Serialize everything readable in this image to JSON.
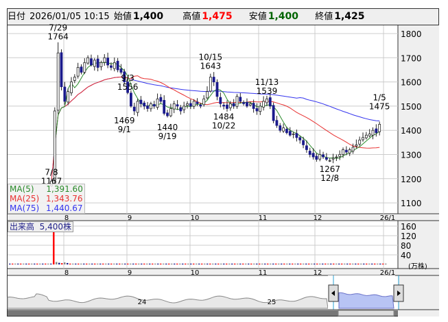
{
  "header": {
    "date_label": "日付",
    "datetime": "2026/01/05 10:15",
    "open_label": "始値",
    "open": "1,400",
    "high_label": "高値",
    "high": "1,475",
    "low_label": "安値",
    "low": "1,400",
    "close_label": "終値",
    "close": "1,425"
  },
  "colors": {
    "ma5": "#2a8a2a",
    "ma25": "#e83030",
    "ma75": "#3333ee",
    "high": "#ff0000",
    "low": "#006400",
    "candle_down": "#1a1a8c",
    "vol_up": "#ff0000",
    "vol_down": "#1a1a8c"
  },
  "legend": {
    "ma5_label": "MA(5)",
    "ma5": "1,391.60",
    "ma25_label": "MA(25)",
    "ma25": "1,343.76",
    "ma75_label": "MA(75)",
    "ma75": "1,440.67"
  },
  "volume": {
    "label": "出来高",
    "value": "5,400株",
    "unit": "(万株)"
  },
  "chart_data": {
    "type": "candlestick",
    "y_ticks": [
      1100,
      1200,
      1300,
      1400,
      1500,
      1600,
      1700,
      1800
    ],
    "ylim": [
      1060,
      1840
    ],
    "x_ticks": [
      "8",
      "9",
      "10",
      "11",
      "12",
      "26/1"
    ],
    "closes": [
      1190,
      1480,
      1720,
      1580,
      1520,
      1560,
      1600,
      1620,
      1660,
      1640,
      1680,
      1700,
      1670,
      1690,
      1660,
      1680,
      1700,
      1670,
      1660,
      1680,
      1650,
      1640,
      1600,
      1556,
      1500,
      1480,
      1520,
      1510,
      1500,
      1490,
      1510,
      1500,
      1530,
      1520,
      1470,
      1460,
      1490,
      1510,
      1500,
      1480,
      1500,
      1510,
      1500,
      1520,
      1510,
      1500,
      1530,
      1560,
      1620,
      1600,
      1540,
      1510,
      1500,
      1490,
      1510,
      1500,
      1540,
      1520,
      1510,
      1500,
      1510,
      1490,
      1480,
      1500,
      1520,
      1530,
      1500,
      1440,
      1420,
      1400,
      1410,
      1390,
      1380,
      1385,
      1370,
      1360,
      1340,
      1320,
      1300,
      1290,
      1280,
      1300,
      1290,
      1280,
      1275,
      1285,
      1290,
      1300,
      1320,
      1310,
      1320,
      1330,
      1340,
      1360,
      1370,
      1380,
      1385,
      1400,
      1390,
      1425
    ],
    "annotations": [
      {
        "date": "7/8",
        "value": "1167",
        "i": 0,
        "pos": "above"
      },
      {
        "date": "7/29",
        "value": "1764",
        "i": 2,
        "pos": "above"
      },
      {
        "date": "9/3",
        "value": "1556",
        "i": 23,
        "pos": "above"
      },
      {
        "date": "9/1",
        "value": "1469",
        "i": 22,
        "pos": "below"
      },
      {
        "date": "9/19",
        "value": "1440",
        "i": 35,
        "pos": "below"
      },
      {
        "date": "10/15",
        "value": "1643",
        "i": 48,
        "pos": "above"
      },
      {
        "date": "10/22",
        "value": "1484",
        "i": 52,
        "pos": "below"
      },
      {
        "date": "11/13",
        "value": "1539",
        "i": 65,
        "pos": "above"
      },
      {
        "date": "12/8",
        "value": "1267",
        "i": 84,
        "pos": "below"
      },
      {
        "date": "1/5",
        "value": "1475",
        "i": 99,
        "pos": "above"
      }
    ],
    "volume_ticks": [
      40,
      80,
      120,
      160
    ],
    "volume_spike": {
      "i": 2,
      "value": 160
    },
    "nav_labels": [
      "24",
      "25"
    ]
  }
}
